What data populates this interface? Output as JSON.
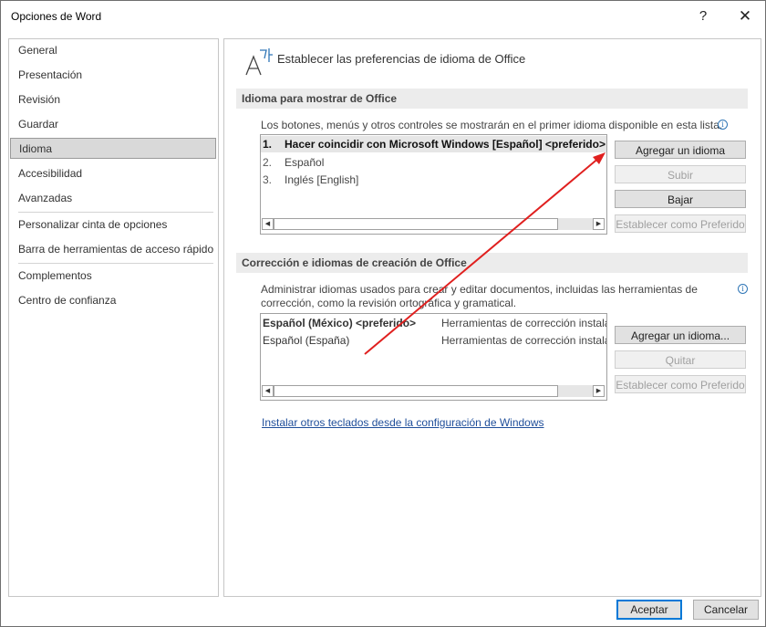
{
  "window": {
    "title": "Opciones de Word",
    "help_glyph": "?",
    "close_glyph": "✕"
  },
  "sidebar": {
    "items": [
      {
        "label": "General"
      },
      {
        "label": "Presentación"
      },
      {
        "label": "Revisión"
      },
      {
        "label": "Guardar"
      },
      {
        "label": "Idioma",
        "active": true
      },
      {
        "label": "Accesibilidad"
      },
      {
        "label": "Avanzadas"
      },
      {
        "label": "Personalizar cinta de opciones"
      },
      {
        "label": "Barra de herramientas de acceso rápido"
      },
      {
        "label": "Complementos"
      },
      {
        "label": "Centro de confianza"
      }
    ]
  },
  "header": {
    "icon_name": "language-icon",
    "title": "Establecer las preferencias de idioma de Office"
  },
  "display_section": {
    "title": "Idioma para mostrar de Office",
    "description": "Los botones, menús y otros controles se mostrarán en el primer idioma disponible en esta lista.",
    "languages": [
      {
        "num": "1.",
        "label": "Hacer coincidir con Microsoft Windows [Español] <preferido>",
        "selected": true
      },
      {
        "num": "2.",
        "label": "Español"
      },
      {
        "num": "3.",
        "label": "Inglés [English]"
      }
    ],
    "buttons": {
      "add": "Agregar un idioma",
      "up": "Subir",
      "down": "Bajar",
      "set_preferred": "Establecer como Preferido"
    }
  },
  "authoring_section": {
    "title": "Corrección e idiomas de creación de Office",
    "description_line1": "Administrar idiomas usados para crear y editar documentos, incluidas las herramientas de",
    "description_line2": "corrección, como la revisión ortográfica y gramatical.",
    "languages": [
      {
        "name": "Español (México) <preferido>",
        "status": "Herramientas de corrección instaladas",
        "bold": true
      },
      {
        "name": "Español (España)",
        "status": "Herramientas de corrección instaladas"
      }
    ],
    "buttons": {
      "add": "Agregar un idioma...",
      "remove": "Quitar",
      "set_preferred": "Establecer como Preferido"
    },
    "link": "Instalar otros teclados desde la configuración de Windows"
  },
  "footer": {
    "ok": "Aceptar",
    "cancel": "Cancelar"
  },
  "colors": {
    "accent": "#0078d7",
    "annotation_arrow": "#e0201f",
    "link": "#1f4e9a"
  }
}
